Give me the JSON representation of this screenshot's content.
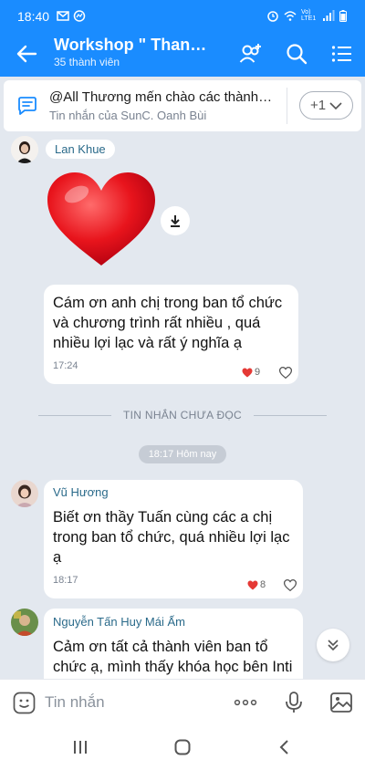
{
  "status_bar": {
    "time": "18:40",
    "network": "Vo) LTE1"
  },
  "header": {
    "title": "Workshop \" Thanh Lọ...",
    "members": "35 thành viên"
  },
  "pinned": {
    "text": "@All Thương mến chào các thành vi...",
    "sender": "Tin nhắn của SunC. Oanh Bùi",
    "more_label": "+1"
  },
  "messages": [
    {
      "sender": "Lan Khue",
      "text": "Cám ơn anh chị  trong ban tổ chức và  chương trình rất nhiều , quá nhiều lợi lạc và rất ý nghĩa ạ",
      "time": "17:24",
      "reaction_count": "9"
    },
    {
      "sender": "Vũ Hương",
      "text": "Biết ơn thầy Tuấn cùng các a chị trong ban tổ chức, quá nhiều lợi lạc ạ",
      "time": "18:17",
      "reaction_count": "8"
    },
    {
      "sender": "Nguyễn Tấn Huy Mái Ấm",
      "text": "Cảm ơn tất cả thành viên ban tổ chức ạ, mình thấy khóa học bên Inti Foundation lại thấy lợi lạc rất nhiều ạ"
    }
  ],
  "unread_label": "TIN NHẮN CHƯA ĐỌC",
  "time_separator": "18:17 Hôm nay",
  "input": {
    "placeholder": "Tin nhắn"
  },
  "colors": {
    "brand": "#1a8cff",
    "background": "#e3e8ef",
    "reaction_heart": "#e53935"
  }
}
